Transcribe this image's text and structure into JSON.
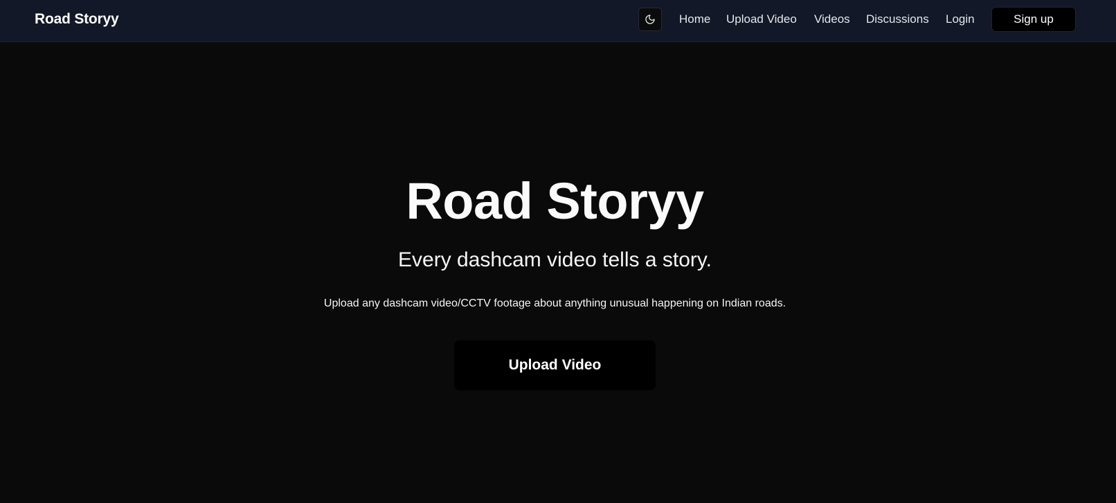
{
  "header": {
    "brand": "Road Storyy",
    "theme_toggle_icon": "moon-icon",
    "nav": {
      "home": "Home",
      "upload_video": "Upload Video",
      "videos": "Videos",
      "discussions": "Discussions",
      "login": "Login"
    },
    "signup_label": "Sign up"
  },
  "hero": {
    "title": "Road Storyy",
    "subtitle": "Every dashcam video tells a story.",
    "description": "Upload any dashcam video/CCTV footage about anything unusual happening on Indian roads.",
    "cta_label": "Upload Video"
  },
  "colors": {
    "header_background": "#121827",
    "page_background": "#0a0a0a",
    "button_background": "#000000",
    "text_primary": "#ffffff"
  }
}
